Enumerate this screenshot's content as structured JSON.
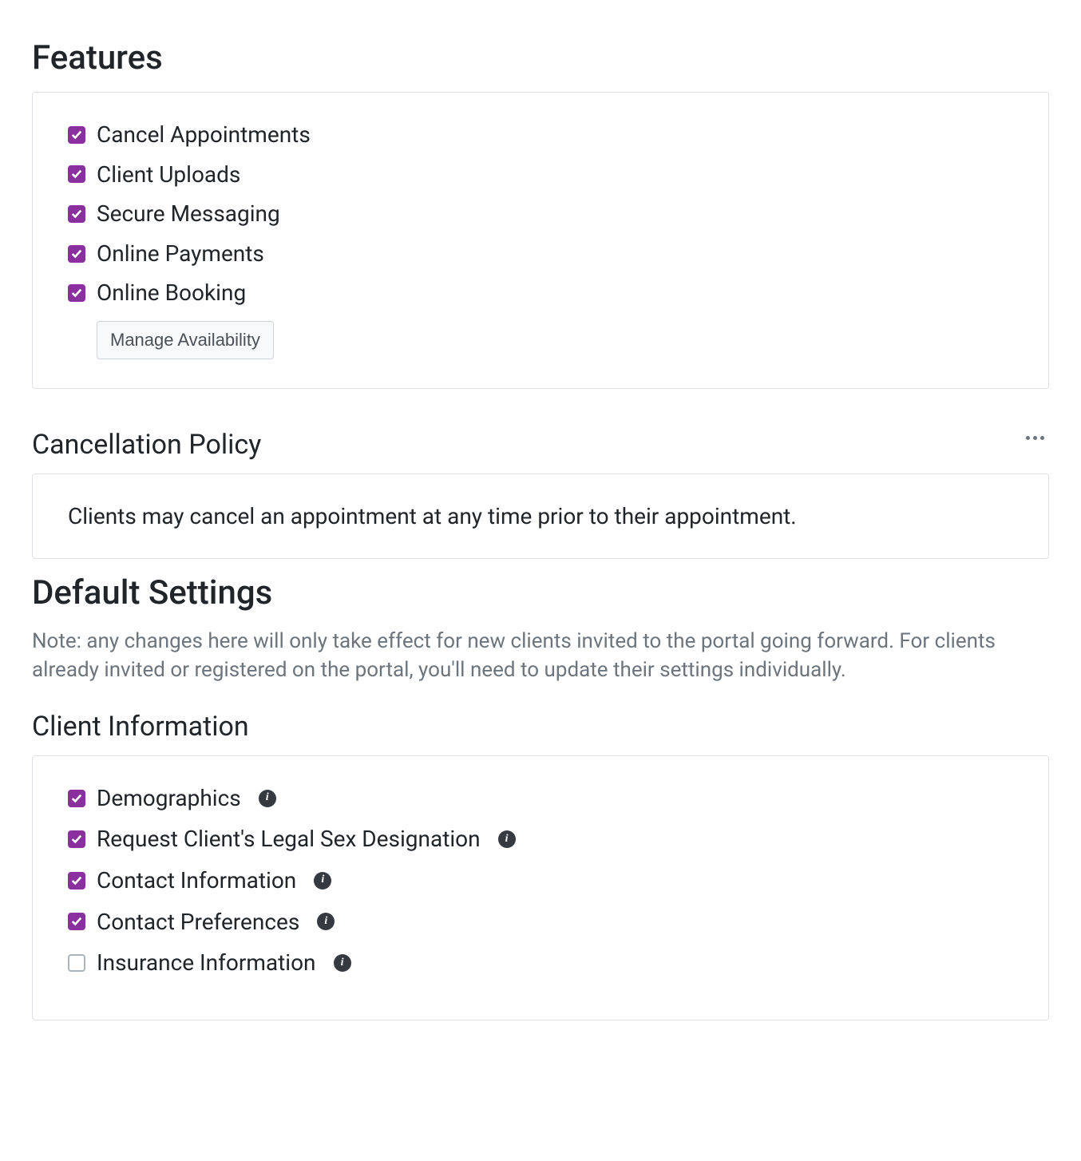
{
  "features": {
    "title": "Features",
    "items": [
      {
        "label": "Cancel Appointments",
        "checked": true
      },
      {
        "label": "Client Uploads",
        "checked": true
      },
      {
        "label": "Secure Messaging",
        "checked": true
      },
      {
        "label": "Online Payments",
        "checked": true
      },
      {
        "label": "Online Booking",
        "checked": true
      }
    ],
    "manage_button": "Manage Availability"
  },
  "cancellation": {
    "title": "Cancellation Policy",
    "text": "Clients may cancel an appointment at any time prior to their appointment."
  },
  "default_settings": {
    "title": "Default Settings",
    "note": "Note: any changes here will only take effect for new clients invited to the portal going forward. For clients already invited or registered on the portal, you'll need to update their settings individually."
  },
  "client_info": {
    "title": "Client Information",
    "items": [
      {
        "label": "Demographics",
        "checked": true,
        "info": true
      },
      {
        "label": "Request Client's Legal Sex Designation",
        "checked": true,
        "info": true
      },
      {
        "label": "Contact Information",
        "checked": true,
        "info": true
      },
      {
        "label": "Contact Preferences",
        "checked": true,
        "info": true
      },
      {
        "label": "Insurance Information",
        "checked": false,
        "info": true
      }
    ]
  }
}
